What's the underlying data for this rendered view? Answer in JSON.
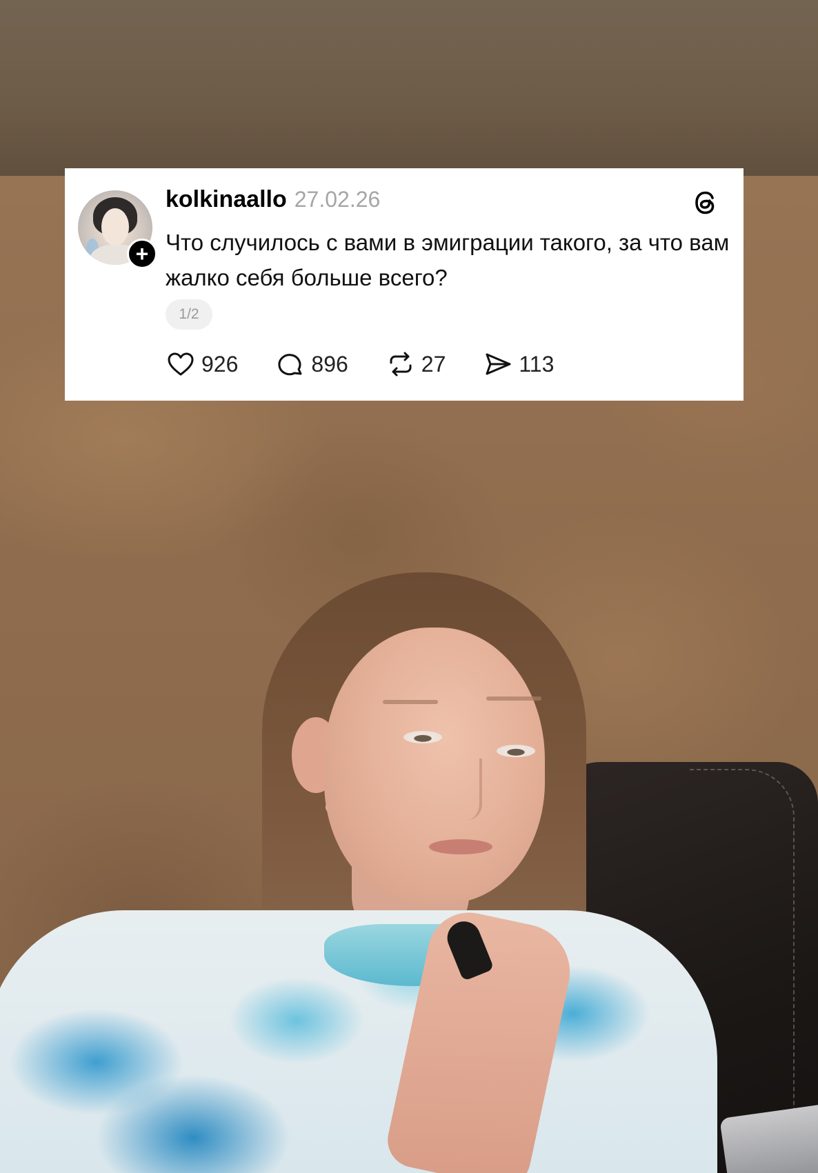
{
  "post": {
    "username": "kolkinaallo",
    "date": "27.02.26",
    "text": "Что случилось с вами в эмиграции такого, за что вам жалко себя больше всего?",
    "page_indicator": "1/2",
    "follow_symbol": "+",
    "stats": {
      "likes": "926",
      "replies": "896",
      "reposts": "27",
      "shares": "113"
    }
  },
  "icons": {
    "like": "heart-icon",
    "reply": "comment-icon",
    "repost": "repost-icon",
    "share": "share-icon",
    "brand": "threads-logo-icon"
  },
  "colors": {
    "card_bg": "#ffffff",
    "date_gray": "#a5a5a5",
    "text": "#111111"
  }
}
